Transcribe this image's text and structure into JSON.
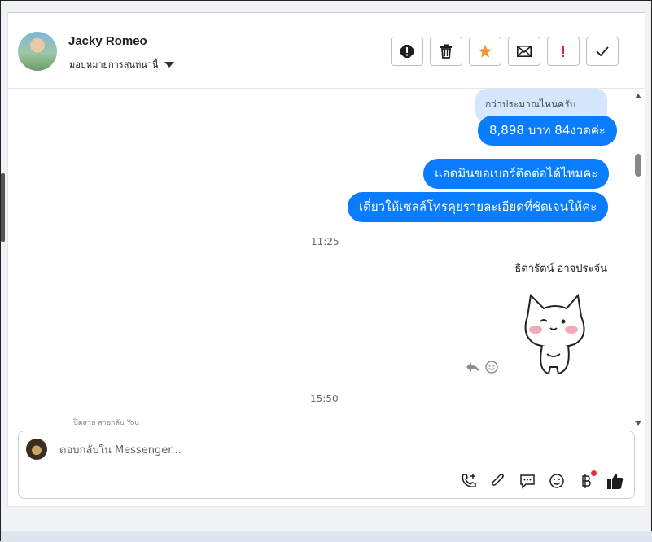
{
  "header": {
    "name": "Jacky Romeo",
    "assign_label": "มอบหมายการสนทนานี้"
  },
  "actions": [
    {
      "name": "report-icon"
    },
    {
      "name": "trash-icon"
    },
    {
      "name": "star-icon",
      "color": "#f7923a"
    },
    {
      "name": "mail-icon"
    },
    {
      "name": "important-icon",
      "color": "#e41e3f"
    },
    {
      "name": "check-icon"
    }
  ],
  "messages": {
    "quoted": "กว่าประมาณไหนครับ",
    "m1": "8,898 บาท 84งวดค่ะ",
    "m2": "แอดมินขอเบอร์ติดต่อได้ไหมคะ",
    "m3": "เดี๋ยวให้เซลล์โทรคุยรายละเอียดที่ชัดเจนให้ค่ะ",
    "time1": "11:25",
    "sender": "ธิดารัตน์ อาจประจัน",
    "time2": "15:50",
    "cut_text": "ปิดสาย สายกลับ You"
  },
  "composer": {
    "placeholder": "ตอบกลับใน Messenger..."
  },
  "colors": {
    "bubble": "#0a7cff",
    "ghost_bubble": "#d5e6ff",
    "notif_dot": "#f02849"
  }
}
